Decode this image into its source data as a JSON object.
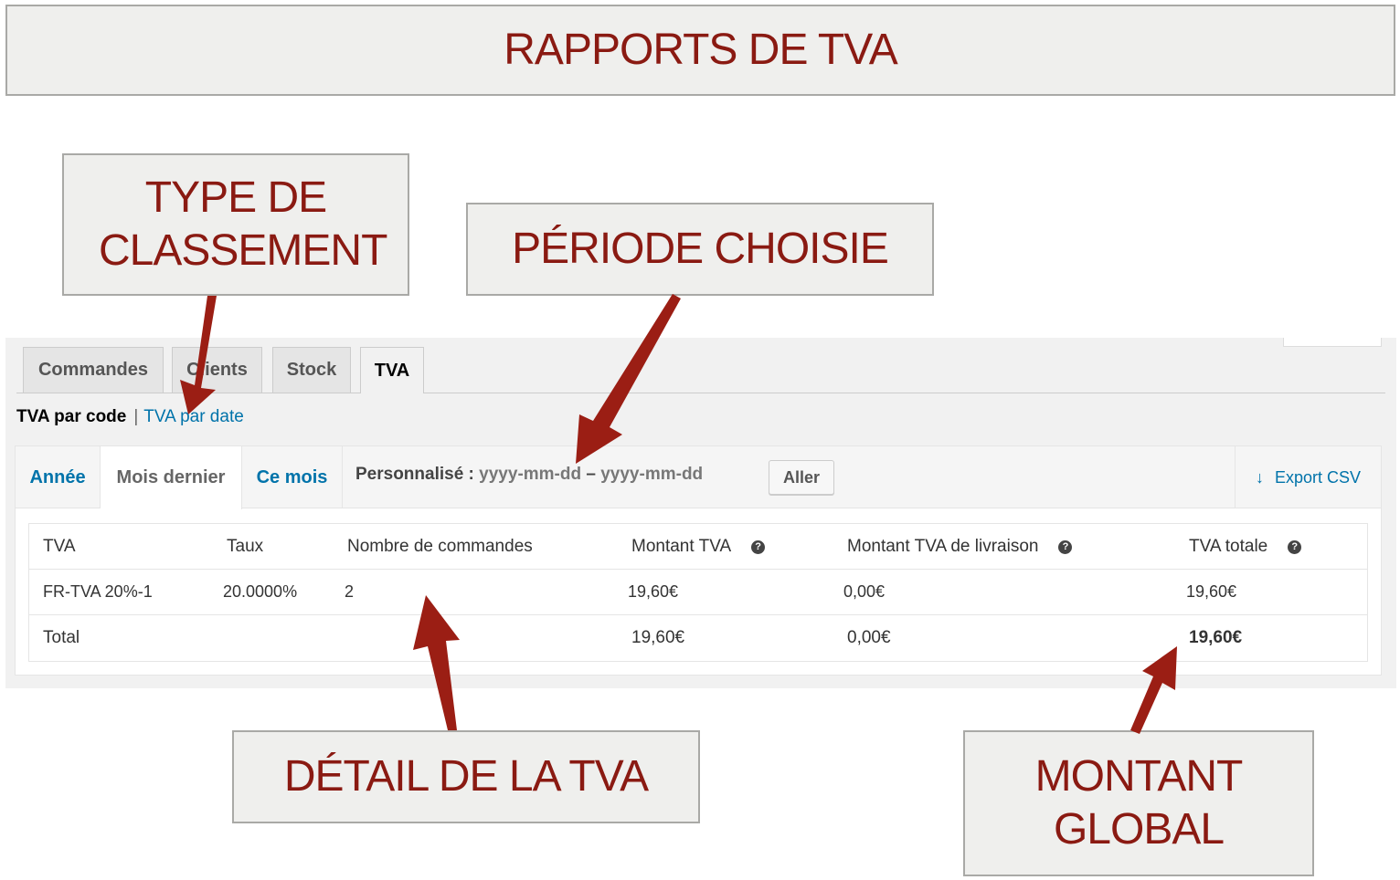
{
  "callouts": {
    "title": "RAPPORTS DE TVA",
    "type_classement": "TYPE DE CLASSEMENT",
    "periode": "PÉRIODE CHOISIE",
    "detail": "DÉTAIL DE LA TVA",
    "montant": "MONTANT GLOBAL"
  },
  "tabs": [
    {
      "label": "Commandes"
    },
    {
      "label": "Clients"
    },
    {
      "label": "Stock"
    },
    {
      "label": "TVA",
      "active": true
    }
  ],
  "subnav": {
    "current": "TVA par code",
    "separator": "|",
    "link": "TVA par date"
  },
  "ranges": {
    "annee": "Année",
    "mois_dernier": "Mois dernier",
    "ce_mois": "Ce mois",
    "custom_label": "Personnalisé :",
    "date_from_placeholder": "yyyy-mm-dd",
    "date_sep": "–",
    "date_to_placeholder": "yyyy-mm-dd",
    "go": "Aller",
    "export": "Export CSV"
  },
  "table": {
    "headers": [
      "TVA",
      "Taux",
      "Nombre de commandes",
      "Montant TVA",
      "Montant TVA de livraison",
      "TVA totale"
    ],
    "help_icon": "?",
    "rows": [
      [
        "FR-TVA 20%-1",
        "20.0000%",
        "2",
        "19,60€",
        "0,00€",
        "19,60€"
      ]
    ],
    "total": [
      "Total",
      "19,60€",
      "0,00€",
      "19,60€"
    ]
  },
  "colors": {
    "callout_text": "#8a1a12",
    "arrow": "#9b1e14",
    "link": "#0073aa"
  }
}
